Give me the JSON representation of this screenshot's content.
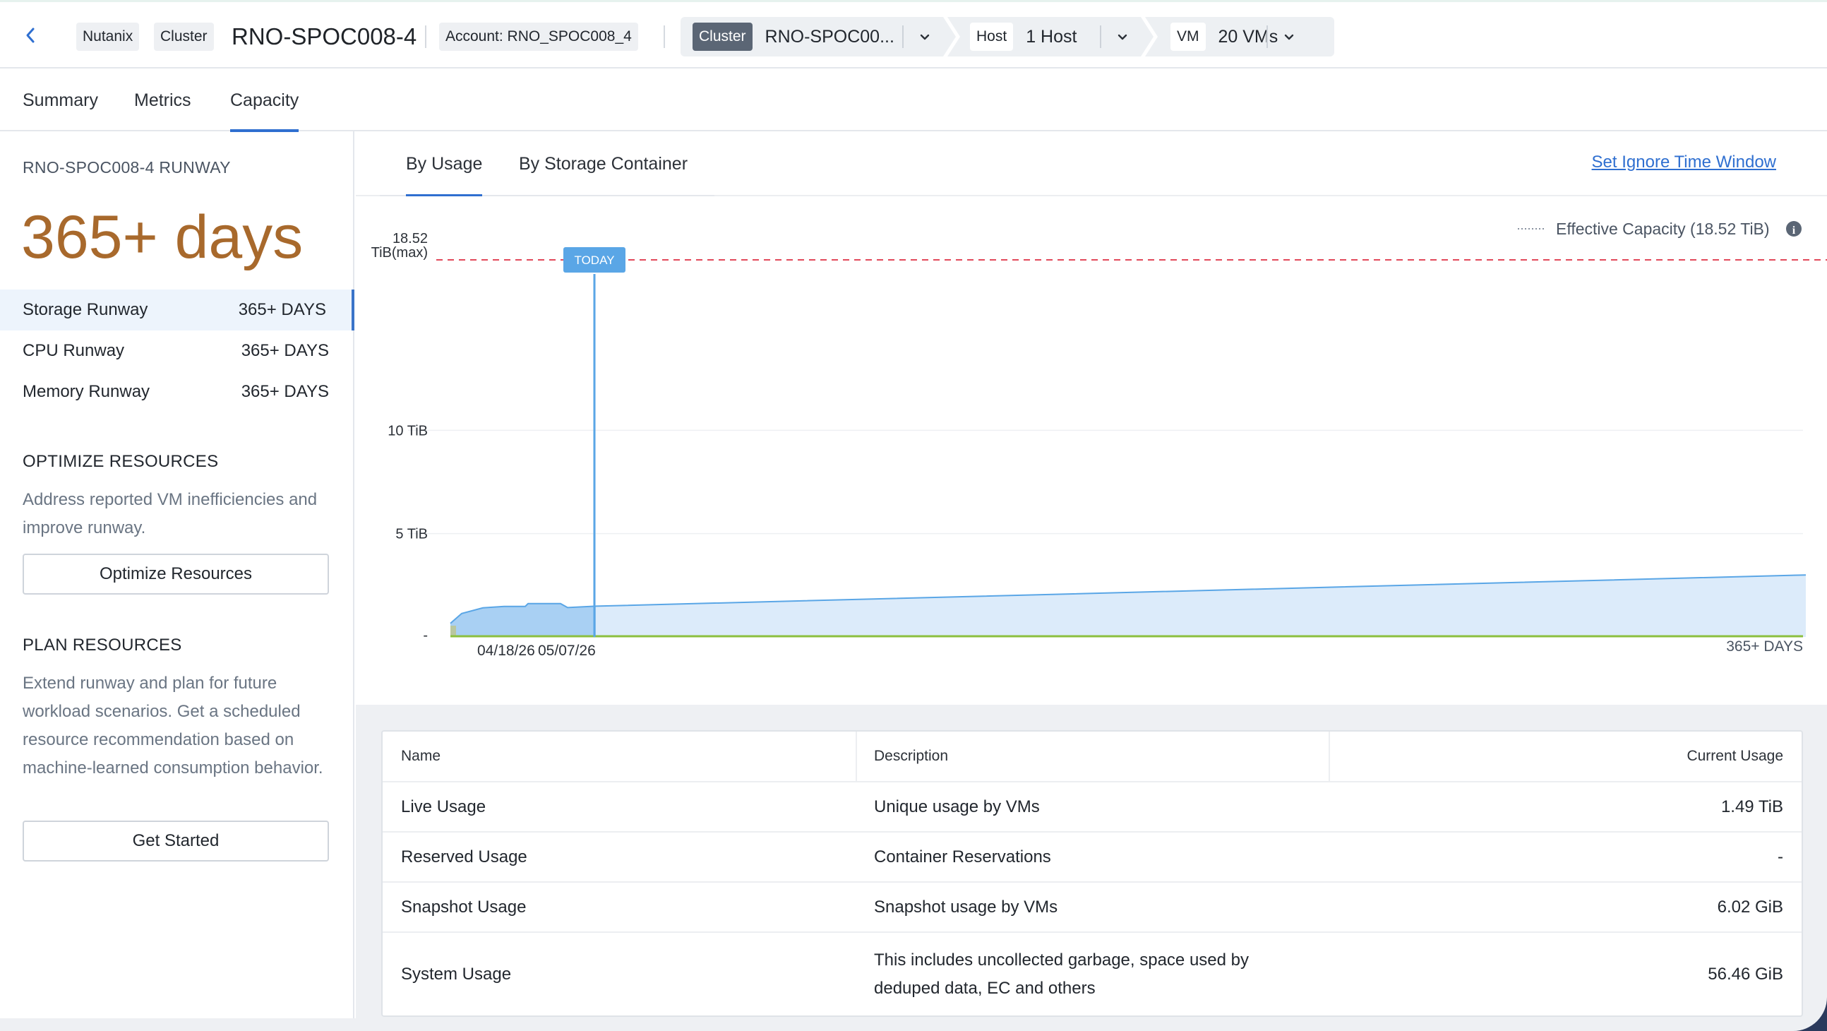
{
  "header": {
    "back_icon": "chevron-left-icon",
    "tag_nutanix": "Nutanix",
    "tag_cluster": "Cluster",
    "title": "RNO-SPOC008-4",
    "account": "Account: RNO_SPOC008_4",
    "scope": [
      {
        "type": "Cluster",
        "value": "RNO-SPOC00..."
      },
      {
        "type": "Host",
        "value": "1 Host"
      },
      {
        "type": "VM",
        "value": "20 VMs"
      }
    ]
  },
  "tabs": [
    "Summary",
    "Metrics",
    "Capacity"
  ],
  "active_tab": "Capacity",
  "sidebar": {
    "runway_title": "RNO-SPOC008-4 RUNWAY",
    "runway_value": "365+ days",
    "runways": [
      {
        "label": "Storage Runway",
        "value": "365+ DAYS",
        "selected": true
      },
      {
        "label": "CPU Runway",
        "value": "365+ DAYS",
        "selected": false
      },
      {
        "label": "Memory Runway",
        "value": "365+ DAYS",
        "selected": false
      }
    ],
    "optimize": {
      "title": "OPTIMIZE RESOURCES",
      "text": "Address reported VM inefficiencies and improve runway.",
      "button": "Optimize Resources"
    },
    "plan": {
      "title": "PLAN RESOURCES",
      "text": "Extend runway and plan for future workload scenarios. Get a scheduled resource recommendation based on machine-learned consumption behavior.",
      "button": "Get Started"
    }
  },
  "main": {
    "subtabs": [
      "By Usage",
      "By Storage Container"
    ],
    "active_subtab": "By Usage",
    "ignore_link": "Set Ignore Time Window",
    "legend_label": "Effective Capacity (18.52 TiB)",
    "info_icon": "info-icon",
    "today_label": "TODAY"
  },
  "chart_data": {
    "type": "area",
    "y_max_label_line1": "18.52",
    "y_max_label_line2": "TiB(max)",
    "y_ticks": [
      "10 TiB",
      "5 TiB",
      "-"
    ],
    "x_labels": [
      "04/18/26",
      "05/07/26",
      "365+ DAYS"
    ],
    "effective_capacity_tib": 18.52,
    "ylim": [
      0,
      18.52
    ],
    "series": [
      {
        "name": "",
        "color": "#5aa6e6",
        "x": [
          "04/18/26",
          "05/07/26",
          "365+ DAYS"
        ],
        "values": [
          1.0,
          1.49,
          3.0
        ]
      }
    ],
    "colors": {
      "capacity_line": "#e2495a",
      "usage": "#5aa6e6",
      "usage_fill": "#dcebfa",
      "baseline": "#8cbf3f"
    }
  },
  "table": {
    "headers": [
      "Name",
      "Description",
      "Current Usage"
    ],
    "rows": [
      {
        "name": "Live Usage",
        "description": "Unique usage by VMs",
        "usage": "1.49 TiB"
      },
      {
        "name": "Reserved Usage",
        "description": "Container Reservations",
        "usage": "-"
      },
      {
        "name": "Snapshot Usage",
        "description": "Snapshot usage by VMs",
        "usage": "6.02 GiB"
      },
      {
        "name": "System Usage",
        "description": "This includes uncollected garbage, space used by deduped data, EC and others",
        "usage": "56.46 GiB"
      }
    ]
  }
}
